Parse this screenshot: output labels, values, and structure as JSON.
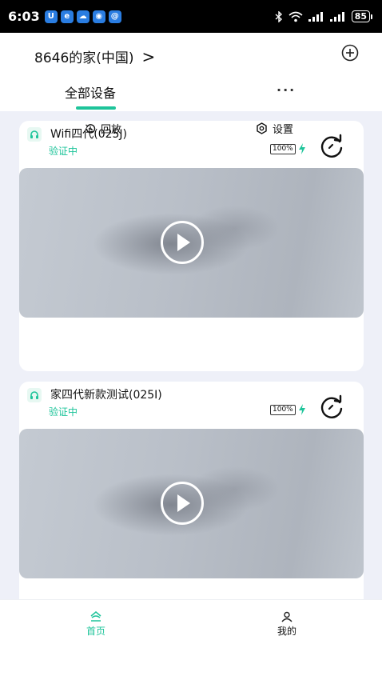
{
  "status_bar": {
    "time": "6:03",
    "battery": "85",
    "apps": [
      {
        "icon": "app-shield-icon",
        "glyph": "U",
        "color": "#2a7de1"
      },
      {
        "icon": "app-chat-icon",
        "glyph": "e",
        "color": "#2a7de1"
      },
      {
        "icon": "app-cloud-icon",
        "glyph": "☁",
        "color": "#2a7de1"
      },
      {
        "icon": "app-robot-icon",
        "glyph": "◉",
        "color": "#2a7de1"
      },
      {
        "icon": "app-swirl-icon",
        "glyph": "@",
        "color": "#2a7de1"
      }
    ]
  },
  "header": {
    "home_name": "8646的家(中国)",
    "chevron": ">",
    "add_icon": "plus-circle-icon"
  },
  "tabs": {
    "active_label": "全部设备",
    "more_label": "···"
  },
  "devices": [
    {
      "name": "Wifi四代(025J)",
      "status": "验证中",
      "battery": "100%",
      "actions": {
        "playback": "回放",
        "settings": "设置"
      }
    },
    {
      "name": "家四代新款测试(025I)",
      "status": "验证中",
      "battery": "100%"
    }
  ],
  "bottom_nav": {
    "home": "首页",
    "mine": "我的"
  },
  "colors": {
    "accent": "#1ec49a",
    "page_bg": "#eef0f8"
  }
}
